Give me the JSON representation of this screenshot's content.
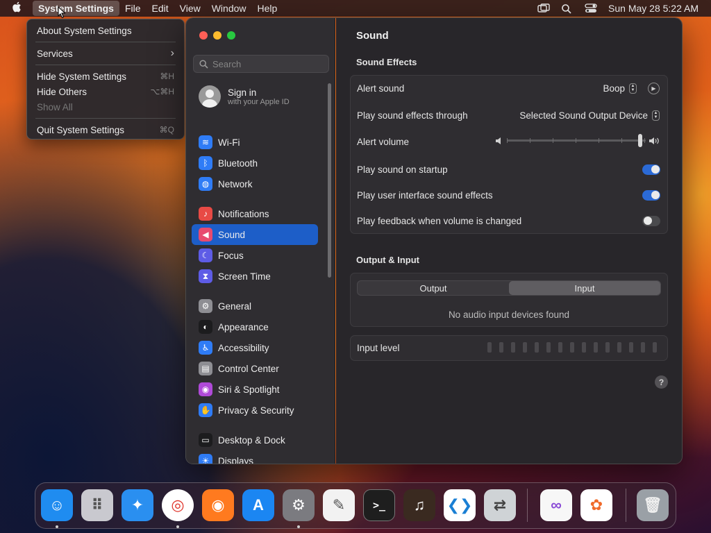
{
  "menubar": {
    "app_name": "System Settings",
    "items": [
      "File",
      "Edit",
      "View",
      "Window",
      "Help"
    ],
    "datetime": "Sun May 28  5:22 AM"
  },
  "app_menu": {
    "items": [
      {
        "label": "About System Settings",
        "shortcut": ""
      },
      {
        "label": "Services",
        "shortcut": "›"
      },
      {
        "label": "Hide System Settings",
        "shortcut": "⌘H"
      },
      {
        "label": "Hide Others",
        "shortcut": "⌥⌘H"
      },
      {
        "label": "Show All",
        "shortcut": ""
      },
      {
        "label": "Quit System Settings",
        "shortcut": "⌘Q"
      }
    ]
  },
  "sidebar": {
    "search_placeholder": "Search",
    "signin_title": "Sign in",
    "signin_subtitle": "with your Apple ID",
    "items": [
      {
        "label": "Wi-Fi",
        "icon": "wifi-icon",
        "color": "#2f7cf6"
      },
      {
        "label": "Bluetooth",
        "icon": "bluetooth-icon",
        "color": "#2f7cf6"
      },
      {
        "label": "Network",
        "icon": "network-icon",
        "color": "#2f7cf6"
      },
      {
        "label": "Notifications",
        "icon": "bell-icon",
        "color": "#e84a45"
      },
      {
        "label": "Sound",
        "icon": "speaker-icon",
        "color": "#e84a6f"
      },
      {
        "label": "Focus",
        "icon": "moon-icon",
        "color": "#5e5ce6"
      },
      {
        "label": "Screen Time",
        "icon": "hourglass-icon",
        "color": "#5e5ce6"
      },
      {
        "label": "General",
        "icon": "gear-icon",
        "color": "#8e8e93"
      },
      {
        "label": "Appearance",
        "icon": "appearance-icon",
        "color": "#1c1c1e"
      },
      {
        "label": "Accessibility",
        "icon": "accessibility-icon",
        "color": "#2f7cf6"
      },
      {
        "label": "Control Center",
        "icon": "control-center-icon",
        "color": "#8e8e93"
      },
      {
        "label": "Siri & Spotlight",
        "icon": "siri-icon",
        "color": "#b04ad8"
      },
      {
        "label": "Privacy & Security",
        "icon": "hand-icon",
        "color": "#2f7cf6"
      },
      {
        "label": "Desktop & Dock",
        "icon": "dock-icon",
        "color": "#1c1c1e"
      },
      {
        "label": "Displays",
        "icon": "sun-icon",
        "color": "#2f7cf6"
      }
    ]
  },
  "content": {
    "title": "Sound",
    "sound_effects_heading": "Sound Effects",
    "alert_sound_label": "Alert sound",
    "alert_sound_value": "Boop",
    "play_through_label": "Play sound effects through",
    "play_through_value": "Selected Sound Output Device",
    "alert_volume_label": "Alert volume",
    "alert_volume_level": 0.96,
    "startup_label": "Play sound on startup",
    "startup_on": true,
    "ui_sounds_label": "Play user interface sound effects",
    "ui_sounds_on": true,
    "feedback_label": "Play feedback when volume is changed",
    "feedback_on": false,
    "output_input_heading": "Output & Input",
    "tab_output": "Output",
    "tab_input": "Input",
    "no_devices": "No audio input devices found",
    "input_level_label": "Input level",
    "help": "?"
  },
  "dock": {
    "apps": [
      {
        "name": "Finder",
        "icon": "finder-icon",
        "color": "#1f8cf0"
      },
      {
        "name": "Launchpad",
        "icon": "launchpad-icon",
        "color": "#c9c9cf"
      },
      {
        "name": "Safari",
        "icon": "safari-icon",
        "color": "#2a8ff0"
      },
      {
        "name": "Chrome",
        "icon": "chrome-icon",
        "color": "#ffffff"
      },
      {
        "name": "Firefox",
        "icon": "firefox-icon",
        "color": "#ff7a1f"
      },
      {
        "name": "App Store",
        "icon": "appstore-icon",
        "color": "#1b86f2"
      },
      {
        "name": "System Settings",
        "icon": "settings-icon",
        "color": "#7b7b80"
      },
      {
        "name": "TextEdit",
        "icon": "textedit-icon",
        "color": "#f2f2f2"
      },
      {
        "name": "Terminal",
        "icon": "terminal-icon",
        "color": "#1e1e1e"
      },
      {
        "name": "GarageBand",
        "icon": "garageband-icon",
        "color": "#3a2a20"
      },
      {
        "name": "VS Code",
        "icon": "vscode-icon",
        "color": "#ffffff"
      },
      {
        "name": "Migration Assistant",
        "icon": "migration-icon",
        "color": "#cfd3d6"
      },
      {
        "name": "Visual Studio",
        "icon": "visualstudio-icon",
        "color": "#f7f7f7"
      },
      {
        "name": "Photos",
        "icon": "photos-icon",
        "color": "#ffffff"
      },
      {
        "name": "Trash",
        "icon": "trash-icon",
        "color": "#9aa0a6"
      }
    ]
  }
}
